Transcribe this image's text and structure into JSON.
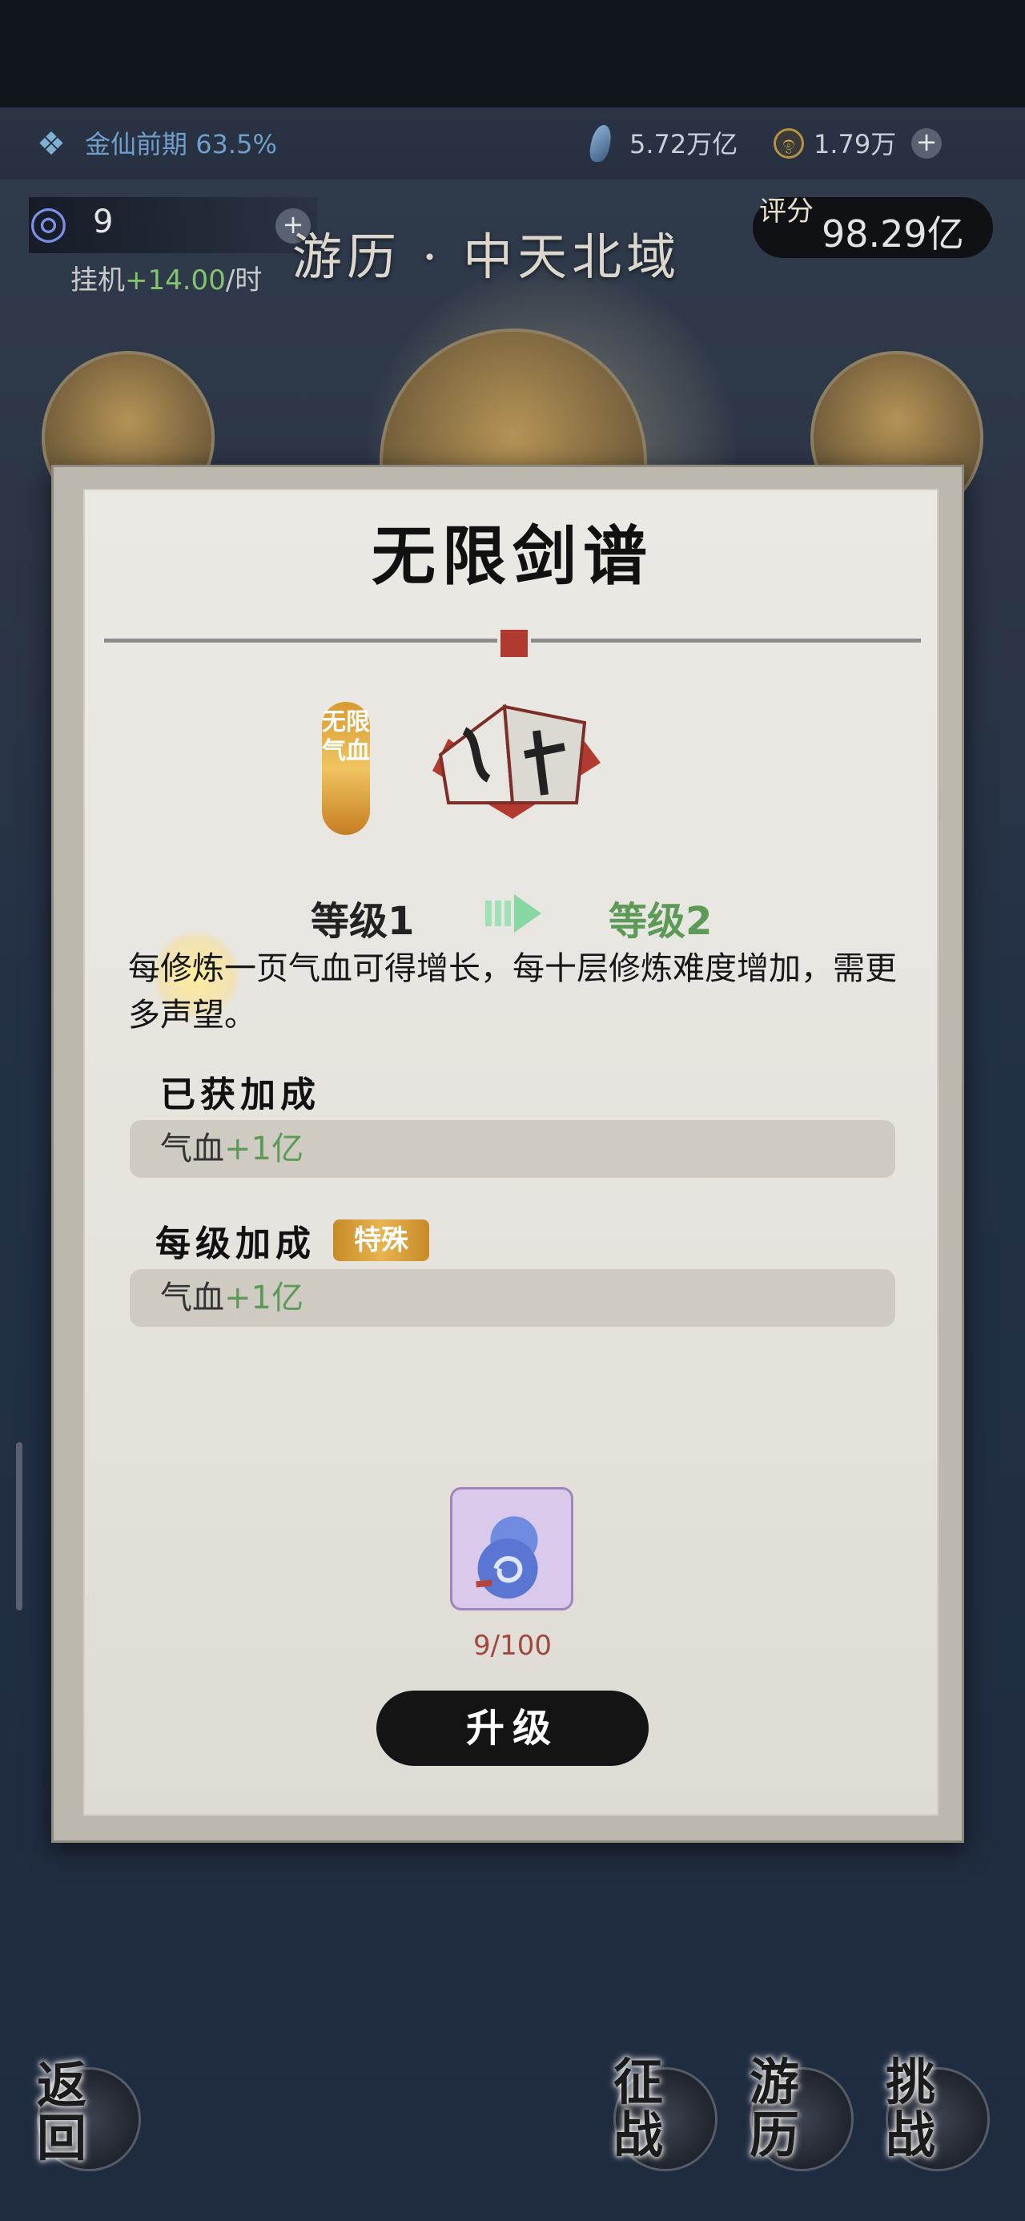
{
  "status_bar": {
    "realm_label": "金仙前期",
    "realm_progress": "63.5%",
    "spirit_stones": "5.72万亿",
    "gold": "1.79万"
  },
  "header": {
    "item_count": "9",
    "idle_prefix": "挂机",
    "idle_rate": "+14.00",
    "idle_suffix": "/时",
    "map_title": "游历 · 中天北域",
    "score_mark": "评分",
    "score": "98.29亿"
  },
  "dialog": {
    "title": "无限剑谱",
    "tag_label": "无限气血",
    "level_from": "等级1",
    "level_to": "等级2",
    "description": "每修炼一页气血可得增长，每十层修炼难度增加，需更多声望。",
    "obtained_title": "已获加成",
    "obtained_stat": "气血",
    "obtained_value": "+1亿",
    "per_level_title": "每级加成",
    "special_badge": "特殊",
    "per_level_stat": "气血",
    "per_level_value": "+1亿",
    "cost": "9/100",
    "upgrade_button": "升级"
  },
  "bottom_nav": {
    "back": "返回",
    "conquest": "征战",
    "travel": "游历",
    "challenge": "挑战"
  },
  "colors": {
    "accent_green": "#5d9a58",
    "realm_blue": "#6f9fca",
    "cost_red": "#a2473f",
    "tag_gold": "#e9b44e"
  }
}
